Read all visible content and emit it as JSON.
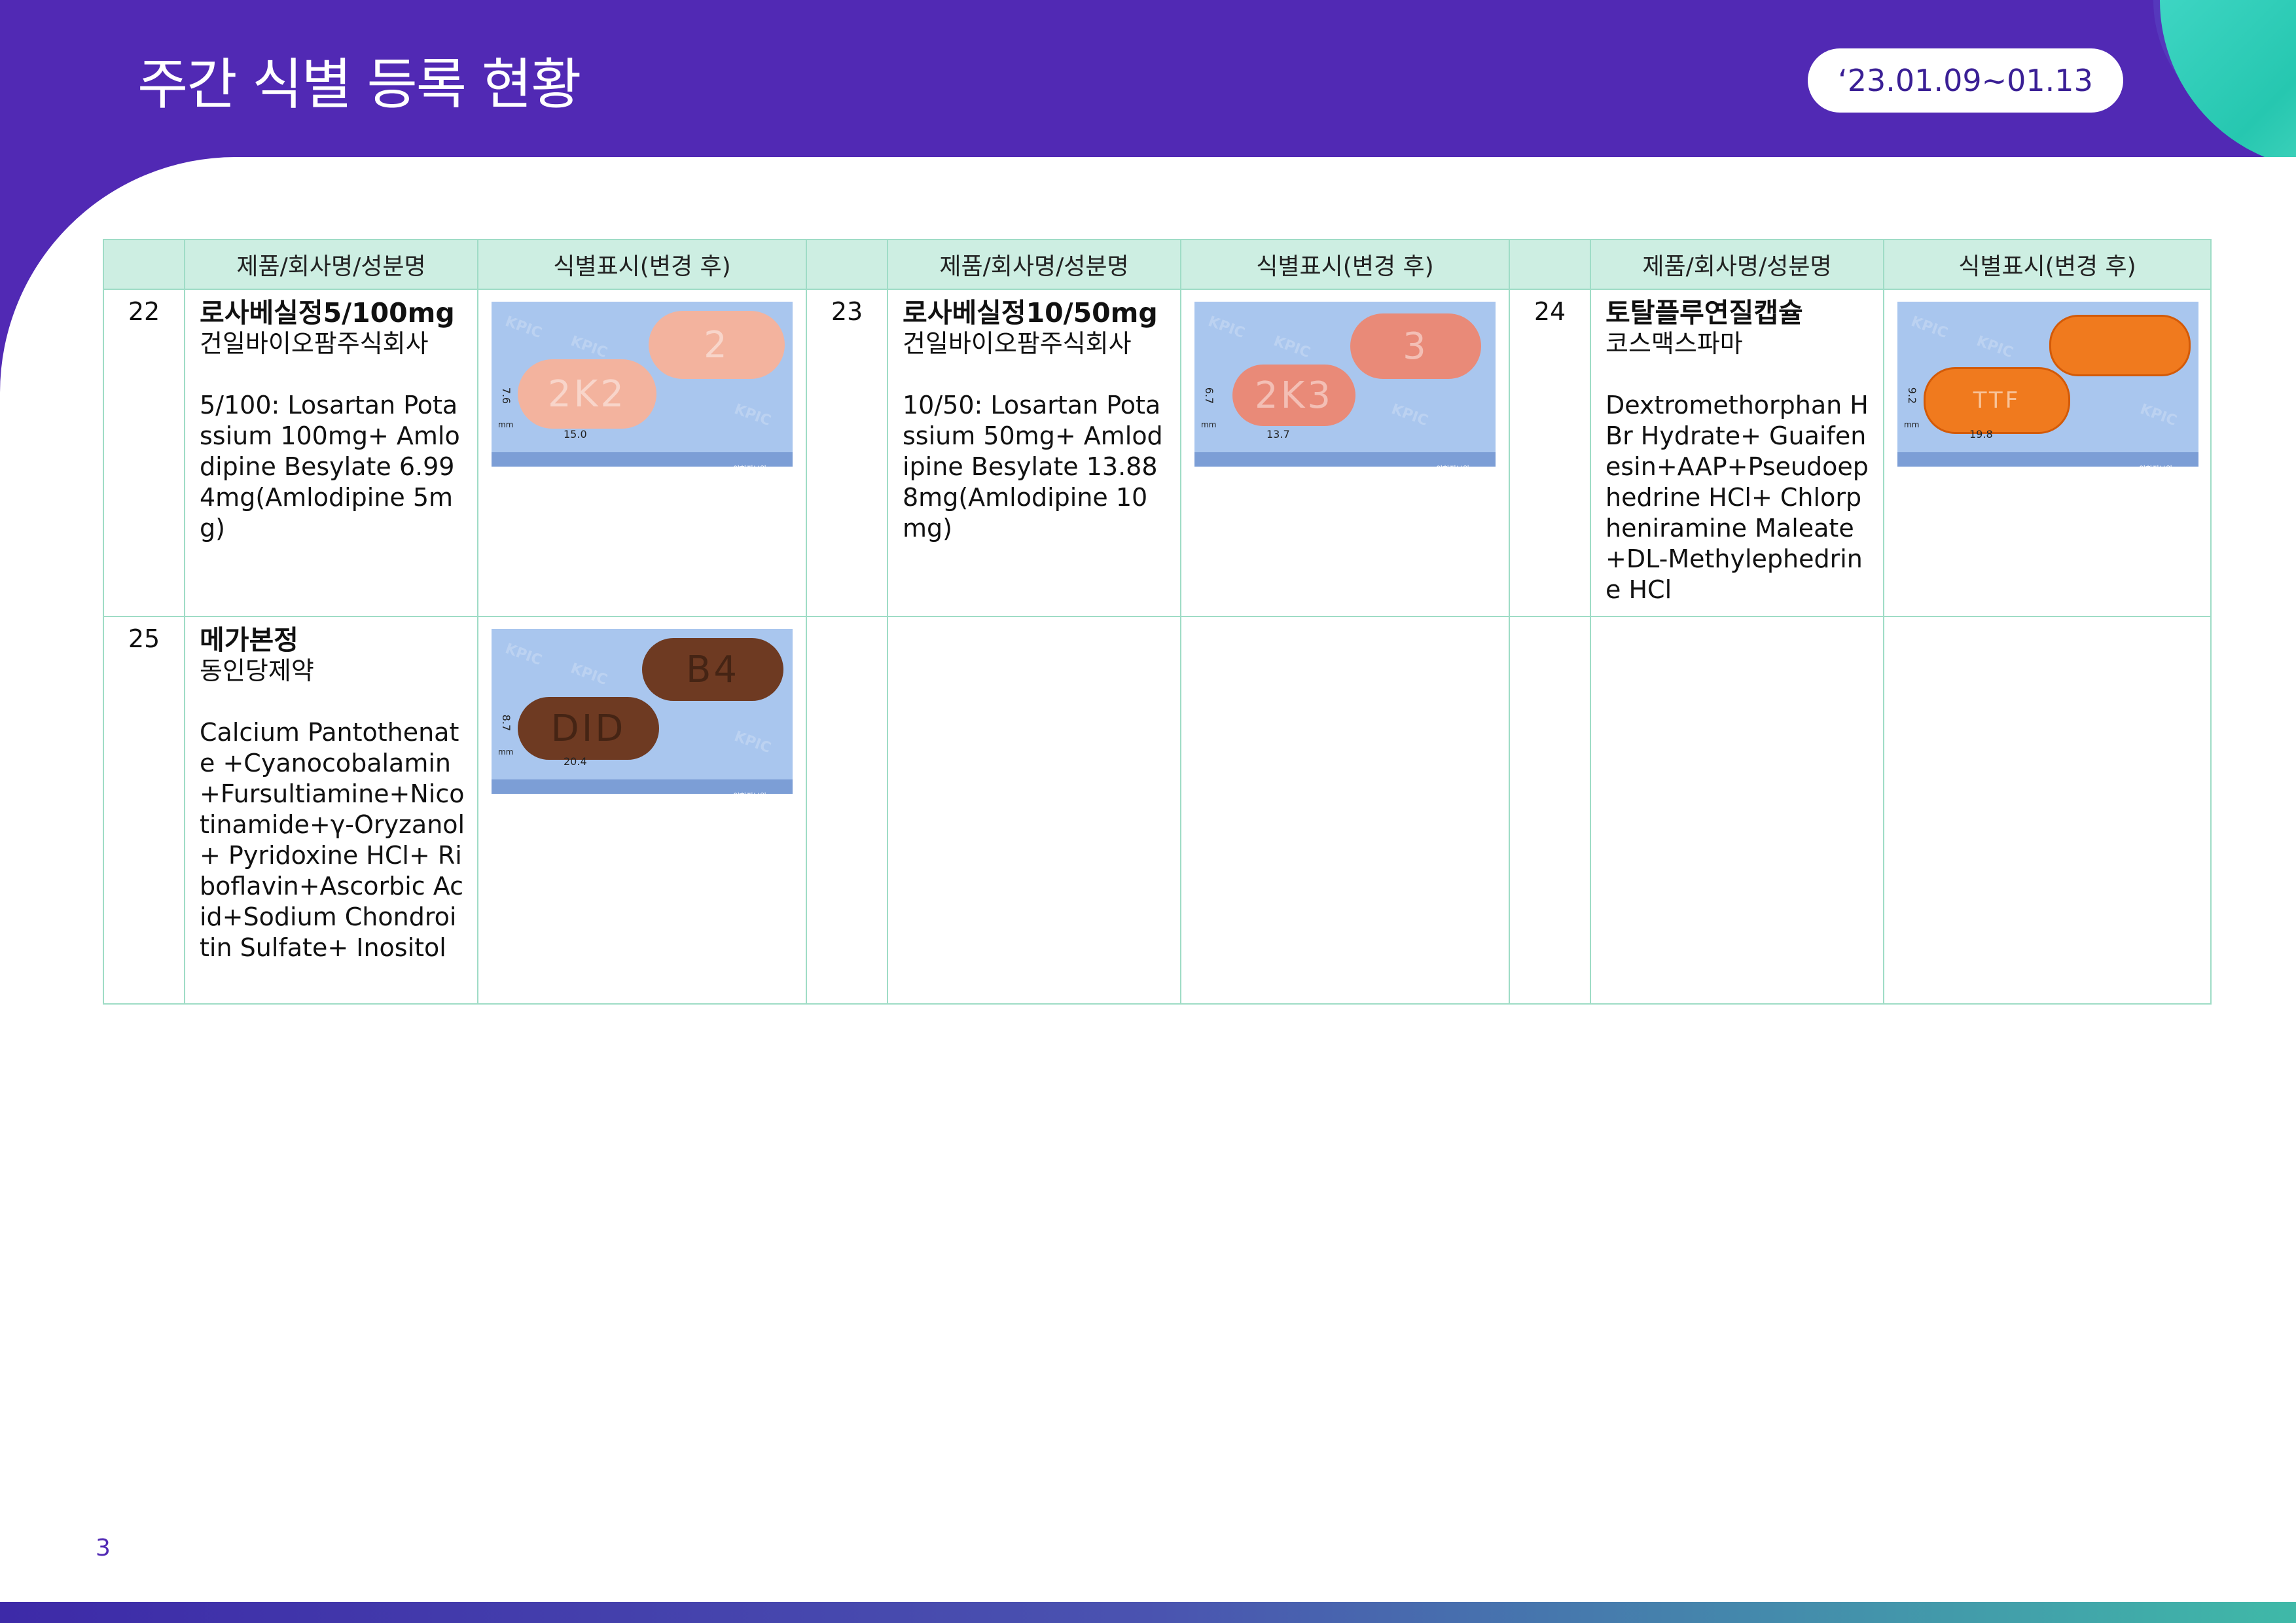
{
  "header": {
    "title": "주간 식별 등록 현황",
    "date_range": "‘23.01.09~01.13"
  },
  "table": {
    "columns": [
      "",
      "제품/회사명/성분명",
      "식별표시(변경 후)",
      "",
      "제품/회사명/성분명",
      "식별표시(변경 후)",
      "",
      "제품/회사명/성분명",
      "식별표시(변경 후)"
    ],
    "items": [
      {
        "no": "22",
        "product": "로사베실정5/100mg",
        "company": "건일바이오팜주식회사",
        "ingredients": "5/100: Losartan Potassium 100mg+ Amlodipine Besylate 6.994mg(Amlodipine 5mg)",
        "photo": {
          "marking_front": "2K2",
          "marking_back": "2",
          "thickness": "7.6",
          "length": "15.0",
          "color": "#f3b39e",
          "watermark": "KPIC",
          "unit": "mm",
          "source": "약학정보원"
        }
      },
      {
        "no": "23",
        "product": "로사베실정10/50mg",
        "company": "건일바이오팜주식회사",
        "ingredients": "10/50: Losartan Potassium 50mg+ Amlodipine Besylate 13.888mg(Amlodipine 10mg)",
        "photo": {
          "marking_front": "2K3",
          "marking_back": "3",
          "thickness": "6.7",
          "length": "13.7",
          "color": "#e98a78",
          "watermark": "KPIC",
          "unit": "mm",
          "source": "약학정보원"
        }
      },
      {
        "no": "24",
        "product": "토탈플루연질캡슐",
        "company": "코스맥스파마",
        "ingredients": "Dextromethorphan HBr Hydrate+ Guaifenesin+AAP+Pseudoephedrine HCl+ Chlorpheniramine Maleate+DL-Methylephedrine HCl",
        "photo": {
          "marking_front": "TTF",
          "marking_back": "",
          "thickness": "9.2",
          "length": "19.8",
          "color": "#f07a1e",
          "watermark": "KPIC",
          "unit": "mm",
          "source": "약학정보원"
        }
      },
      {
        "no": "25",
        "product": "메가본정",
        "company": "동인당제약",
        "ingredients": "Calcium Pantothenate +Cyanocobalamin+Fursultiamine+Nicotinamide+γ-Oryzanol+ Pyridoxine HCl+ Riboflavin+Ascorbic Acid+Sodium Chondroitin Sulfate+ Inositol",
        "photo": {
          "marking_front": "DID",
          "marking_back": "B4",
          "thickness": "8.7",
          "length": "20.4",
          "color": "#6e3a22",
          "watermark": "KPIC",
          "unit": "mm",
          "source": "약학정보원"
        }
      }
    ]
  },
  "page_number": "3"
}
